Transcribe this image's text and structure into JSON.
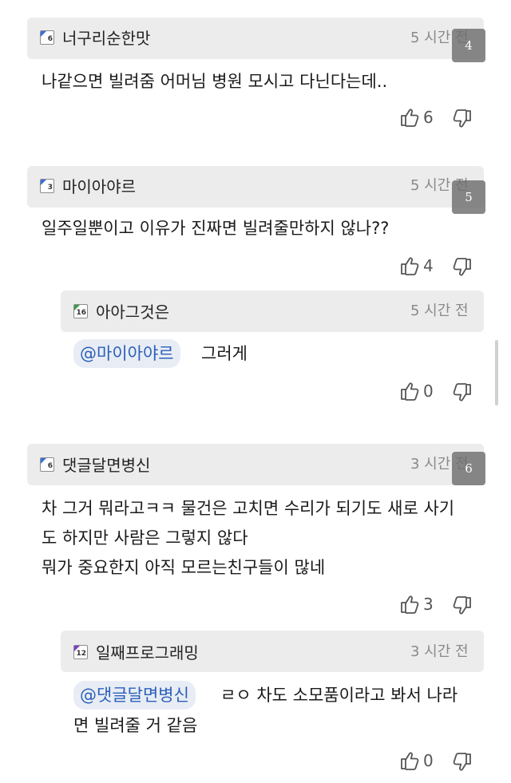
{
  "comments": [
    {
      "nickname": "너구리순한맛",
      "level": "6",
      "time": "5 시간 전",
      "badge": "4",
      "text_lines": [
        "나같으면 빌려줌 어머님 병원 모시고 다닌다는데.."
      ],
      "likes": "6"
    },
    {
      "nickname": "마이아야르",
      "level": "3",
      "time": "5 시간 전",
      "badge": "5",
      "text_lines": [
        "일주일뿐이고 이유가 진짜면 빌려줄만하지 않나??"
      ],
      "likes": "4",
      "reply": {
        "nickname": "아아그것은",
        "level": "16",
        "time": "5 시간 전",
        "mention": "@마이아야르",
        "text_lines": [
          "그러게"
        ],
        "likes": "0"
      }
    },
    {
      "nickname": "댓글달면병신",
      "level": "6",
      "time": "3 시간 전",
      "badge": "6",
      "text_lines": [
        "차 그거 뭐라고ㅋㅋ 물건은 고치면 수리가 되기도 새로 사기",
        "도 하지만 사람은 그렇지 않다",
        "뭐가 중요한지 아직 모르는친구들이 많네"
      ],
      "likes": "3",
      "reply": {
        "nickname": "일째프로그래밍",
        "level": "12",
        "time": "3 시간 전",
        "mention": "@댓글달면병신",
        "text_lines": [
          "ㄹㅇ 차도 소모품이라고 봐서 나라",
          "면 빌려줄 거 같음"
        ],
        "likes": "0"
      }
    }
  ],
  "colors": {
    "header_bg": "#ececec",
    "mention_text": "#2c5fb8",
    "mention_bg": "#e8edf5",
    "level_blue": "#3b6fd6",
    "level_green": "#3a9a4a",
    "level_purple": "#7b3fc4"
  },
  "icons": {
    "like": "thumbs-up-icon",
    "dislike": "thumbs-down-icon",
    "level": "level-badge-icon"
  }
}
